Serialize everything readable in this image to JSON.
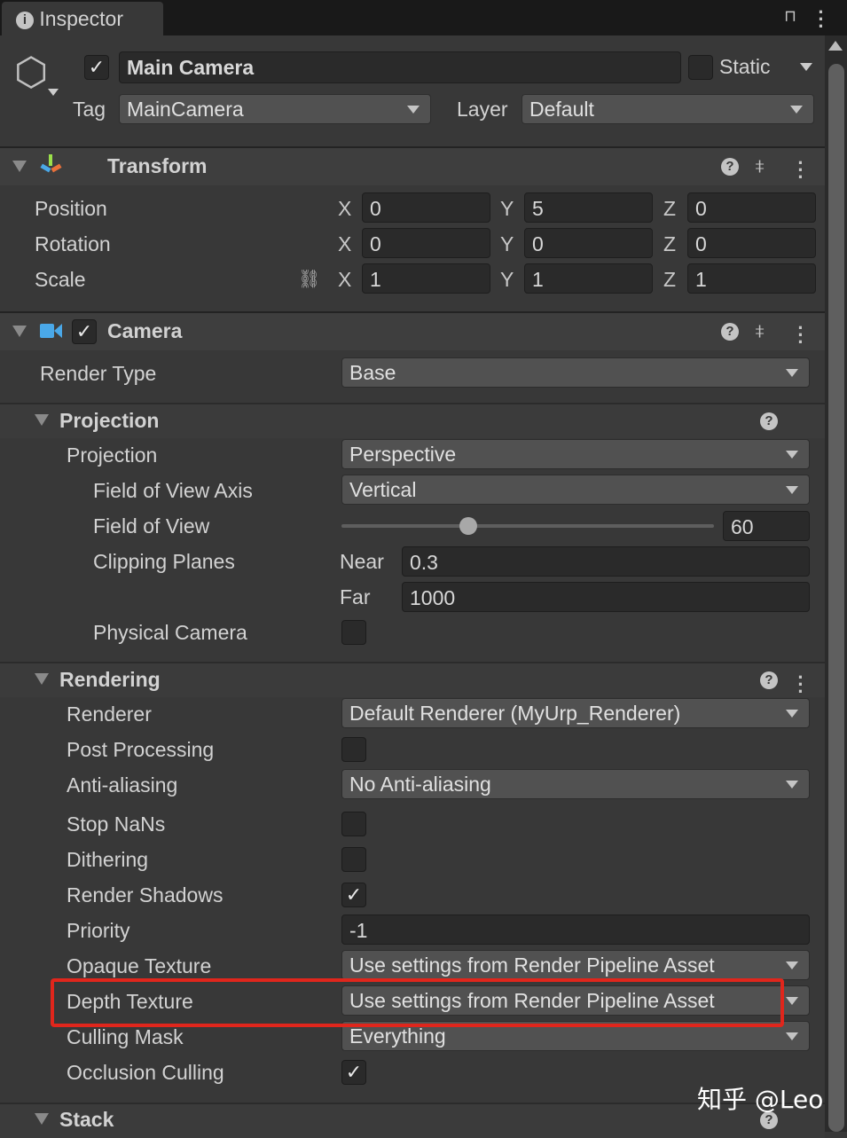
{
  "window": {
    "tab_label": "Inspector",
    "tab_icon": "info-icon"
  },
  "gameobject": {
    "active": true,
    "name": "Main Camera",
    "static_label": "Static",
    "static": false,
    "tag_label": "Tag",
    "tag": "MainCamera",
    "layer_label": "Layer",
    "layer": "Default"
  },
  "transform": {
    "title": "Transform",
    "rows": [
      {
        "label": "Position",
        "x": "0",
        "y": "5",
        "z": "0"
      },
      {
        "label": "Rotation",
        "x": "0",
        "y": "0",
        "z": "0"
      },
      {
        "label": "Scale",
        "x": "1",
        "y": "1",
        "z": "1"
      }
    ]
  },
  "axes": {
    "x": "X",
    "y": "Y",
    "z": "Z"
  },
  "camera": {
    "title": "Camera",
    "enabled": true,
    "render_type_label": "Render Type",
    "render_type": "Base"
  },
  "projection": {
    "title": "Projection",
    "projection_label": "Projection",
    "projection": "Perspective",
    "fov_axis_label": "Field of View Axis",
    "fov_axis": "Vertical",
    "fov_label": "Field of View",
    "fov": "60",
    "fov_slider_fraction": 0.34,
    "clipping_label": "Clipping Planes",
    "near_label": "Near",
    "near": "0.3",
    "far_label": "Far",
    "far": "1000",
    "physical_label": "Physical Camera",
    "physical": false
  },
  "rendering": {
    "title": "Rendering",
    "rows": [
      {
        "label": "Renderer",
        "value": "Default Renderer (MyUrp_Renderer)"
      },
      {
        "label": "Post Processing",
        "checked": false
      },
      {
        "label": "Anti-aliasing",
        "value": "No Anti-aliasing"
      },
      {
        "label": "Stop NaNs",
        "checked": false
      },
      {
        "label": "Dithering",
        "checked": false
      },
      {
        "label": "Render Shadows",
        "checked": true
      },
      {
        "label": "Priority",
        "value": "-1"
      },
      {
        "label": "Opaque Texture",
        "value": "Use settings from Render Pipeline Asset"
      },
      {
        "label": "Depth Texture",
        "value": "Use settings from Render Pipeline Asset"
      },
      {
        "label": "Culling Mask",
        "value": "Everything"
      },
      {
        "label": "Occlusion Culling",
        "checked": true
      }
    ]
  },
  "stack": {
    "title": "Stack"
  },
  "watermark": "知乎 @Leo",
  "colors": {
    "highlight": "#e0261c",
    "background": "#383838"
  }
}
